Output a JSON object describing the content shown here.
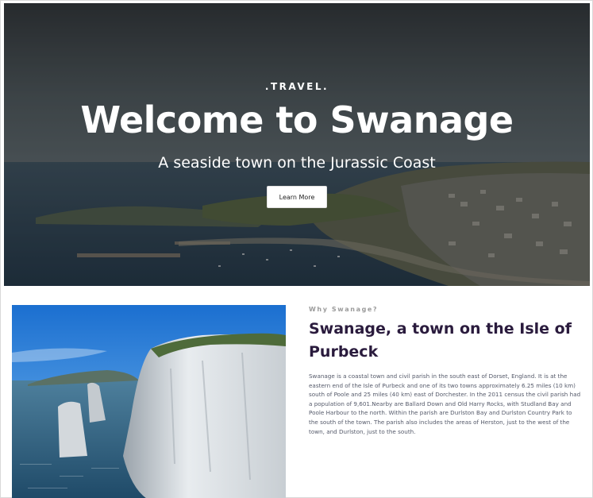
{
  "hero": {
    "kicker": ".TRAVEL.",
    "title": "Welcome to Swanage",
    "subtitle": "A seaside town on the Jurassic Coast",
    "button_label": "Learn More"
  },
  "about": {
    "kicker": "Why Swanage?",
    "title": "Swanage, a town on the Isle of Purbeck",
    "body": "Swanage is a coastal town and civil parish in the south east of Dorset, England. It is at the eastern end of the Isle of Purbeck and one of its two towns approximately 6.25 miles (10 km) south of Poole and 25 miles (40 km) east of Dorchester. In the 2011 census the civil parish had a population of 9,601.Nearby are Ballard Down and Old Harry Rocks, with Studland Bay and Poole Harbour to the north. Within the parish are Durlston Bay and Durlston Country Park to the south of the town. The parish also includes the areas of Herston, just to the west of the town, and Durlston, just to the south."
  },
  "colors": {
    "title_purple": "#2a1b3d",
    "body_gray": "#555a6a"
  }
}
